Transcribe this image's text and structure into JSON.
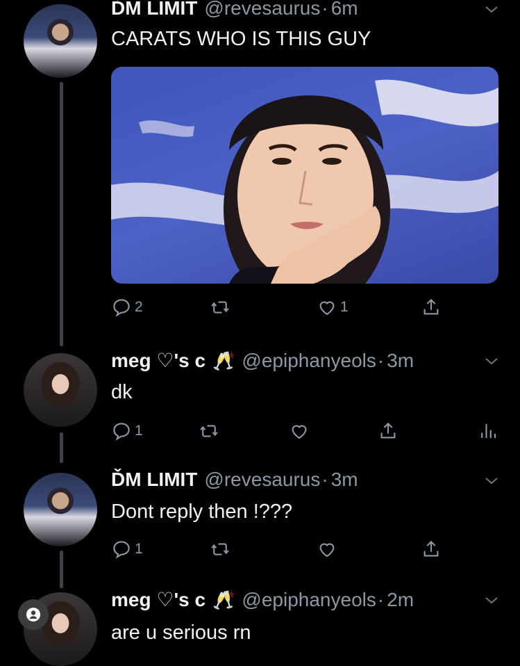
{
  "tweets": [
    {
      "name": "ĎM LIMIT",
      "handle": "@revesaurus",
      "sep": "·",
      "time": "6m",
      "text": "CARATS WHO IS THIS GUY",
      "replies": "2",
      "retweets": "",
      "likes": "1",
      "has_media": true
    },
    {
      "name": "meg ♡'s c",
      "emoji": "🥂",
      "handle": "@epiphanyeols",
      "sep": "·",
      "time": "3m",
      "text": "dk",
      "replies": "1",
      "retweets": "",
      "likes": ""
    },
    {
      "name": "ĎM LIMIT",
      "handle": "@revesaurus",
      "sep": "·",
      "time": "3m",
      "text": "Dont reply then !???",
      "replies": "1",
      "retweets": "",
      "likes": ""
    },
    {
      "name": "meg ♡'s c",
      "emoji": "🥂",
      "handle": "@epiphanyeols",
      "sep": "·",
      "time": "2m",
      "text": "are u serious rn"
    }
  ],
  "icons": {
    "reply": "reply-icon",
    "retweet": "retweet-icon",
    "like": "heart-icon",
    "share": "share-icon",
    "analytics": "analytics-icon",
    "caret": "chevron-down-icon",
    "profile": "profile-icon"
  },
  "colors": {
    "background": "#000000",
    "text": "#f2f2f2",
    "muted": "#8b98a5",
    "thread_line": "#3d4148",
    "media_blue": "#4d62c6"
  }
}
